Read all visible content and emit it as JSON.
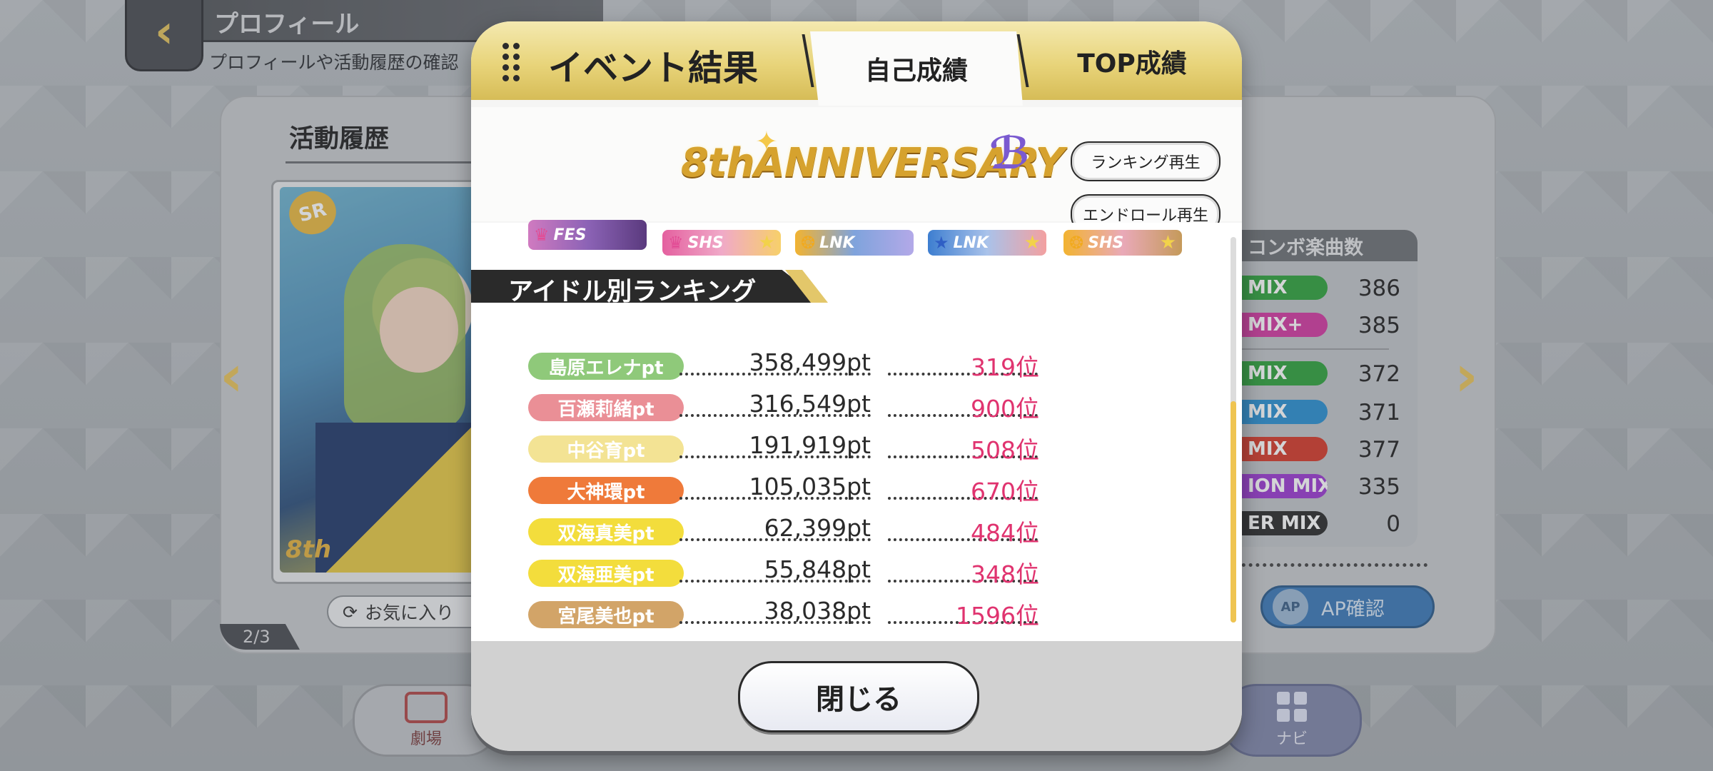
{
  "background": {
    "header": {
      "title": "プロフィール",
      "subtitle": "プロフィールや活動履歴の確認"
    },
    "history_title": "活動履歴",
    "card_rarity": "SR",
    "card_logo": "8th",
    "favorite_label": "お気に入り",
    "page_indicator": "2/3",
    "combo_header": "コンボ楽曲数",
    "combo_rows": [
      {
        "label": "MIX",
        "value": "386",
        "color": "#2fa23d"
      },
      {
        "label": "MIX+",
        "value": "385",
        "color": "#d23aa0"
      },
      {
        "label": "MIX",
        "value": "372",
        "color": "#2fa23d"
      },
      {
        "label": "MIX",
        "value": "371",
        "color": "#2a8fd0"
      },
      {
        "label": "MIX",
        "value": "377",
        "color": "#d43a2a"
      },
      {
        "label": "ION MIX",
        "value": "335",
        "color": "#9b3ad0"
      },
      {
        "label": "ER MIX",
        "value": "0",
        "color": "#2b2b2b"
      }
    ],
    "ap_button": {
      "icon_text": "AP",
      "label": "AP確認"
    },
    "theater_label": "劇場",
    "navi_label": "ナビ"
  },
  "modal": {
    "title": "イベント結果",
    "tabs": [
      "自己成績",
      "TOP成績"
    ],
    "active_tab": "自己成績",
    "logo_text": "8thANNIVERSARY",
    "buttons": {
      "ranking_replay": "ランキング再生",
      "endroll_replay": "エンドロール再生",
      "close": "閉じる"
    },
    "badges": [
      {
        "text": "FES",
        "icon": "crown-icon"
      },
      {
        "text": "SHS",
        "icon": "crown-icon"
      },
      {
        "text": "LNK",
        "icon": "swirl-icon"
      },
      {
        "text": "LNK",
        "icon": "star-icon"
      },
      {
        "text": "SHS",
        "icon": "swirl-icon"
      }
    ],
    "ranking_title": "アイドル別ランキング",
    "ranking": [
      {
        "name": "島原エレナpt",
        "points": "358,499pt",
        "rank": "319位",
        "color": "#8fc97a"
      },
      {
        "name": "百瀬莉緒pt",
        "points": "316,549pt",
        "rank": "900位",
        "color": "#ea8f96"
      },
      {
        "name": "中谷育pt",
        "points": "191,919pt",
        "rank": "508位",
        "color": "#f3e394"
      },
      {
        "name": "大神環pt",
        "points": "105,035pt",
        "rank": "670位",
        "color": "#ef7a3a"
      },
      {
        "name": "双海真美pt",
        "points": "62,399pt",
        "rank": "484位",
        "color": "#f3dd3c"
      },
      {
        "name": "双海亜美pt",
        "points": "55,848pt",
        "rank": "348位",
        "color": "#f3dd3c"
      },
      {
        "name": "宮尾美也pt",
        "points": "38,038pt",
        "rank": "1596位",
        "color": "#d2a468"
      }
    ]
  }
}
